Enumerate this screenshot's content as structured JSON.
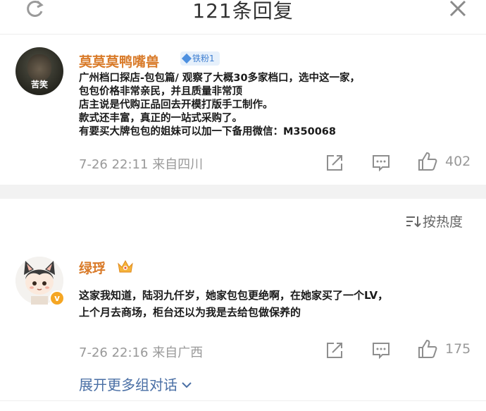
{
  "header": {
    "title": "121条回复",
    "refresh_icon": "refresh-icon",
    "close_icon": "close-icon"
  },
  "comments": [
    {
      "username": "莫莫莫鸭嘴兽",
      "avatar_label": "苦笑",
      "fan_badge": "铁粉1",
      "lines": [
        "广州档口探店-包包篇/ 观察了大概30多家档口，选中这一家，",
        "包包价格非常亲民，并且质量非常顶",
        "店主说是代购正品回去开模打版手工制作。",
        "款式还丰富，真正的一站式采购了。",
        "有要买大牌包包的姐妹可以加一下备用微信：M350068"
      ],
      "timestamp": "7-26 22:11",
      "location": "来自四川",
      "likes": "402"
    },
    {
      "username": "绿琈",
      "lines": [
        "这家我知道，陆羽九仟岁，她家包包更绝啊，在她家买了一个LV，",
        "上个月去商场，柜台还以为我是去给包做保养的"
      ],
      "timestamp": "7-26 22:16",
      "location": "来自广西",
      "likes": "175"
    }
  ],
  "sort": {
    "label": "按热度"
  },
  "expand": {
    "label": "展开更多组对话"
  },
  "colors": {
    "username": "#d97b2a",
    "link": "#4a6fa5",
    "meta": "#999999",
    "band": "#f2f2f2"
  }
}
